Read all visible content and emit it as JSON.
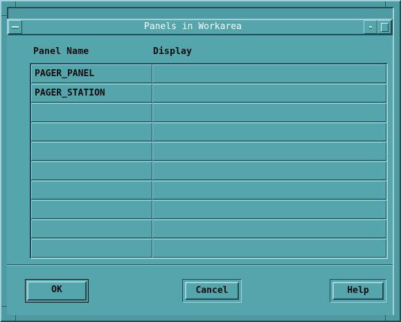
{
  "window": {
    "title": "Panels in Workarea"
  },
  "table": {
    "columns": [
      "Panel Name",
      "Display"
    ],
    "rows": [
      [
        "PAGER_PANEL",
        ""
      ],
      [
        "PAGER_STATION",
        ""
      ],
      [
        "",
        ""
      ],
      [
        "",
        ""
      ],
      [
        "",
        ""
      ],
      [
        "",
        ""
      ],
      [
        "",
        ""
      ],
      [
        "",
        ""
      ],
      [
        "",
        ""
      ],
      [
        "",
        ""
      ]
    ]
  },
  "buttons": {
    "ok": "OK",
    "cancel": "Cancel",
    "help": "Help"
  },
  "icons": {
    "window_menu": "window-menu-icon",
    "minimize": "minimize-icon",
    "maximize": "maximize-icon"
  },
  "colors": {
    "background": "#55a5ad",
    "frame": "#4e9ba3",
    "highlight": "#a3d3d8",
    "shadow": "#1e4e54",
    "text": "#0b0b0b",
    "title_text": "#ffffff"
  }
}
